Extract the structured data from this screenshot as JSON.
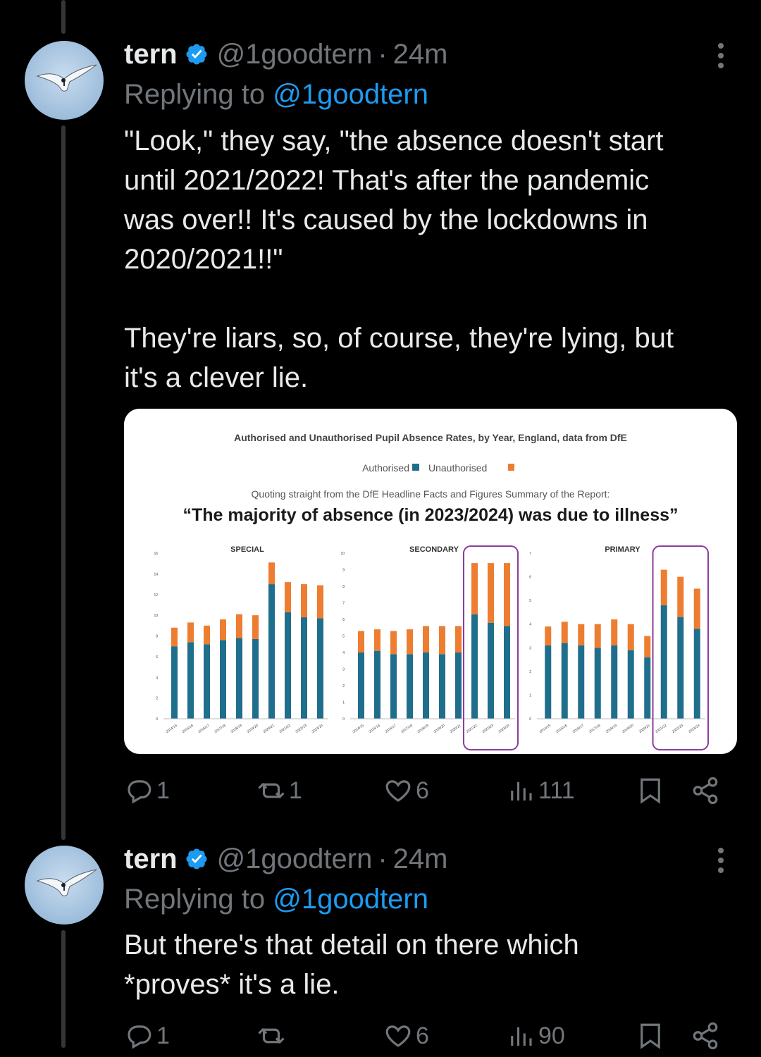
{
  "tweets": [
    {
      "name": "tern",
      "handle": "@1goodtern",
      "separator": "·",
      "time": "24m",
      "replying_prefix": "Replying to ",
      "replying_to": "@1goodtern",
      "text": "\"Look,\" they say, \"the absence doesn't start\nuntil 2021/2022! That's after the pandemic\nwas over!! It's caused by the lockdowns in\n2020/2021!!\"\n\nThey're liars, so, of course, they're lying, but\nit's a clever lie.",
      "stats": {
        "replies": "1",
        "retweets": "1",
        "likes": "6",
        "views": "111"
      }
    },
    {
      "name": "tern",
      "handle": "@1goodtern",
      "separator": "·",
      "time": "24m",
      "replying_prefix": "Replying to ",
      "replying_to": "@1goodtern",
      "text": "But there's that detail on there which\n*proves* it's a lie.",
      "stats": {
        "replies": "1",
        "retweets": "",
        "likes": "6",
        "views": "90"
      }
    }
  ],
  "colors": {
    "accent": "#1d9bf0",
    "authorised": "#1f6e8c",
    "unauthorised": "#ed7d31",
    "highlight": "#8e3c9e"
  },
  "chart_data": {
    "title": "Authorised and Unauthorised Pupil Absence Rates, by Year, England, data from DfE",
    "legend": [
      "Authorised",
      "Unauthorised"
    ],
    "subtitle": "Quoting straight from the DfE Headline Facts and Figures Summary of the Report:",
    "quote": "“The majority of absence (in 2023/2024) was due to illness”",
    "panels": [
      {
        "name": "SPECIAL",
        "type": "bar",
        "stacked": true,
        "ylim": [
          0,
          16
        ],
        "yticks": [
          "0",
          "2",
          "4",
          "6",
          "8",
          "10",
          "12",
          "14",
          "16"
        ],
        "categories": [
          "2014/15",
          "2015/16",
          "2016/17",
          "2017/18",
          "2018/19",
          "2019/20",
          "2020/21",
          "2021/22",
          "2022/23",
          "2023/24"
        ],
        "series": [
          {
            "name": "Authorised",
            "values": [
              7.0,
              7.4,
              7.2,
              7.6,
              7.8,
              7.7,
              13.0,
              10.3,
              9.8,
              9.7
            ]
          },
          {
            "name": "Unauthorised",
            "values": [
              1.8,
              1.9,
              1.8,
              2.0,
              2.3,
              2.3,
              2.1,
              2.9,
              3.2,
              3.2
            ]
          }
        ]
      },
      {
        "name": "SECONDARY",
        "type": "bar",
        "stacked": true,
        "ylim": [
          0,
          10
        ],
        "yticks": [
          "0",
          "1",
          "2",
          "3",
          "4",
          "5",
          "6",
          "7",
          "8",
          "9",
          "10"
        ],
        "categories": [
          "2014/15",
          "2015/16",
          "2016/17",
          "2017/18",
          "2018/19",
          "2019/20",
          "2020/21",
          "2021/22",
          "2022/23",
          "2023/24"
        ],
        "series": [
          {
            "name": "Authorised",
            "values": [
              4.0,
              4.1,
              3.9,
              3.9,
              4.0,
              3.9,
              4.0,
              6.3,
              5.8,
              5.6
            ]
          },
          {
            "name": "Unauthorised",
            "values": [
              1.3,
              1.3,
              1.4,
              1.5,
              1.6,
              1.7,
              1.6,
              3.1,
              3.6,
              3.8
            ]
          }
        ]
      },
      {
        "name": "PRIMARY",
        "type": "bar",
        "stacked": true,
        "ylim": [
          0,
          7
        ],
        "yticks": [
          "0",
          "1",
          "2",
          "3",
          "4",
          "5",
          "6",
          "7"
        ],
        "categories": [
          "2014/15",
          "2015/16",
          "2016/17",
          "2017/18",
          "2018/19",
          "2019/20",
          "2020/21",
          "2021/22",
          "2022/23",
          "2023/24"
        ],
        "series": [
          {
            "name": "Authorised",
            "values": [
              3.1,
              3.2,
              3.1,
              3.0,
              3.1,
              2.9,
              2.6,
              4.8,
              4.3,
              3.8
            ]
          },
          {
            "name": "Unauthorised",
            "values": [
              0.8,
              0.9,
              0.9,
              1.0,
              1.1,
              1.1,
              0.9,
              1.5,
              1.7,
              1.7
            ]
          }
        ]
      }
    ]
  }
}
